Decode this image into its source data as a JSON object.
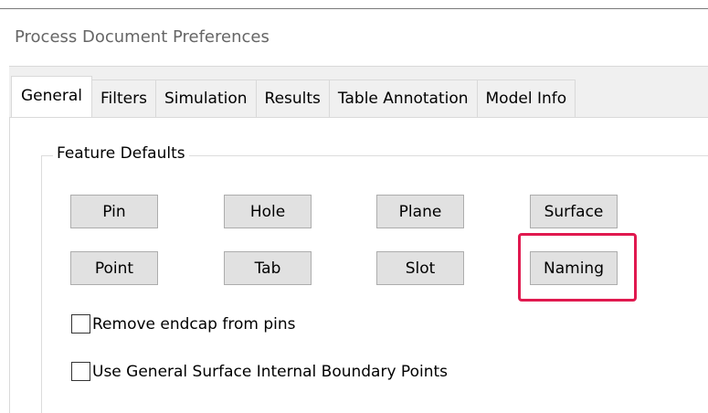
{
  "window": {
    "title": "Process Document Preferences"
  },
  "tabs": [
    {
      "label": "General",
      "active": true
    },
    {
      "label": "Filters",
      "active": false
    },
    {
      "label": "Simulation",
      "active": false
    },
    {
      "label": "Results",
      "active": false
    },
    {
      "label": "Table Annotation",
      "active": false
    },
    {
      "label": "Model Info",
      "active": false
    }
  ],
  "feature_defaults": {
    "label": "Feature Defaults",
    "buttons": [
      {
        "label": "Pin"
      },
      {
        "label": "Hole"
      },
      {
        "label": "Plane"
      },
      {
        "label": "Surface"
      },
      {
        "label": "Point"
      },
      {
        "label": "Tab"
      },
      {
        "label": "Slot"
      },
      {
        "label": "Naming",
        "highlighted": true
      }
    ],
    "highlight_color": "#e0194f"
  },
  "options": [
    {
      "label": "Remove endcap from pins",
      "checked": false
    },
    {
      "label": "Use General Surface Internal Boundary Points",
      "checked": false
    }
  ]
}
